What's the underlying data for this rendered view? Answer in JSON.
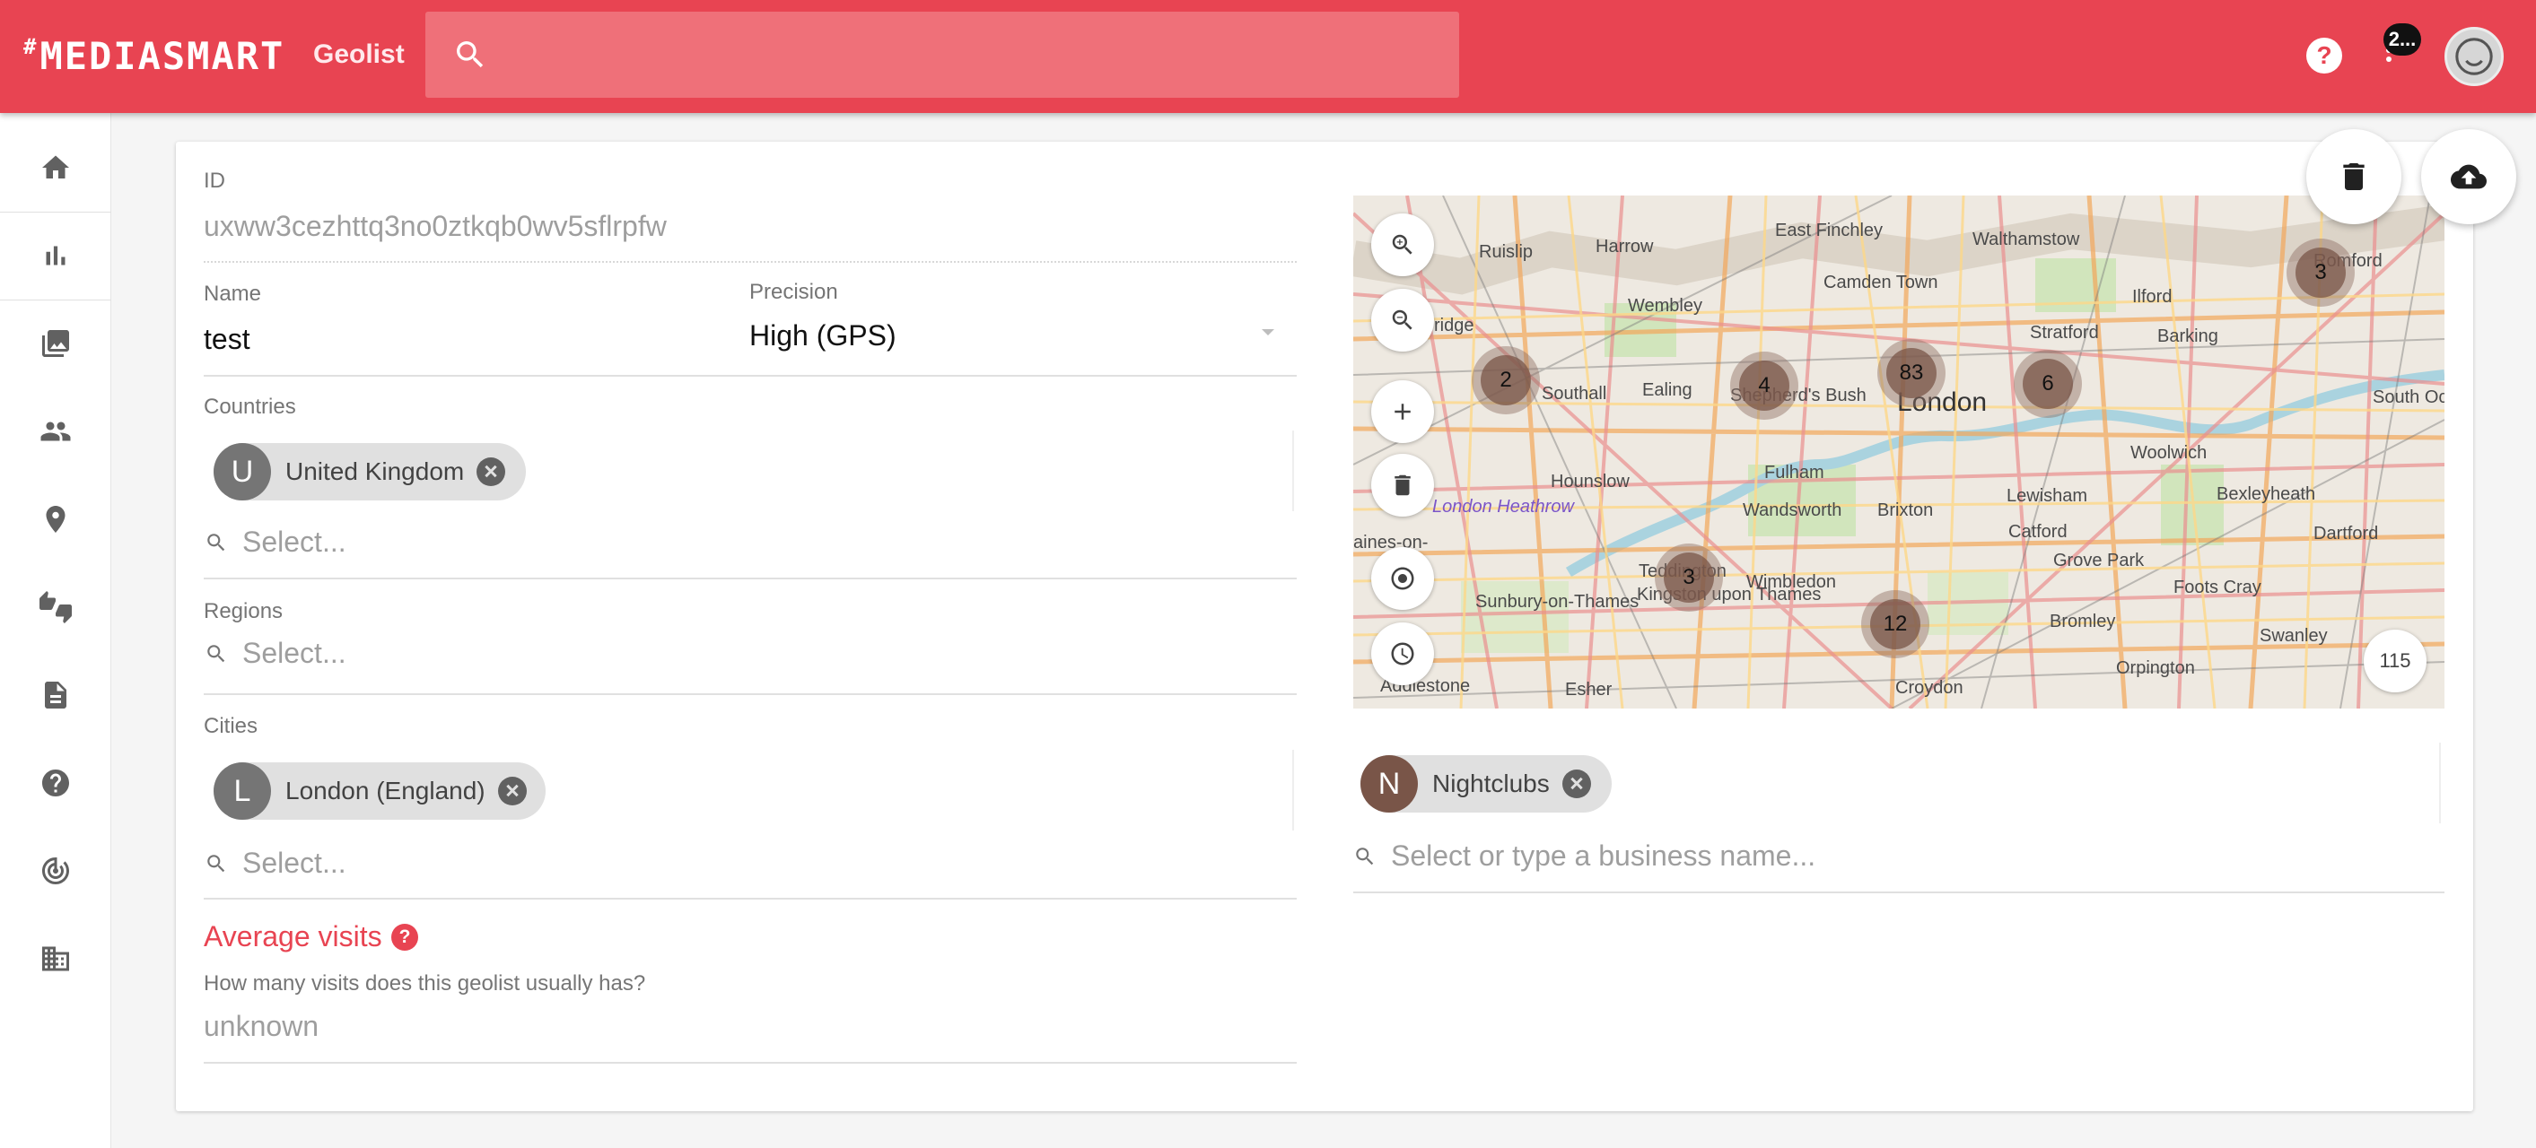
{
  "header": {
    "logo": "MEDIASMART",
    "logo_prefix": "#",
    "title": "Geolist",
    "search_placeholder": "",
    "notification_badge": "2...",
    "help_symbol": "?"
  },
  "sidebar": {
    "items": [
      {
        "name": "home",
        "icon": "home-icon"
      },
      {
        "name": "reports",
        "icon": "bar-chart-icon"
      },
      {
        "name": "creatives",
        "icon": "photo-library-icon"
      },
      {
        "name": "audiences",
        "icon": "people-icon"
      },
      {
        "name": "geolists",
        "icon": "location-pin-icon"
      },
      {
        "name": "feedback",
        "icon": "thumbs-up-down-icon"
      },
      {
        "name": "documents",
        "icon": "document-icon"
      },
      {
        "name": "help",
        "icon": "help-icon"
      },
      {
        "name": "tracking",
        "icon": "track-changes-icon"
      },
      {
        "name": "organization",
        "icon": "building-icon"
      }
    ]
  },
  "form": {
    "id_label": "ID",
    "id_value": "uxww3cezhttq3no0ztkqb0wv5sflrpfw",
    "name_label": "Name",
    "name_value": "test",
    "precision_label": "Precision",
    "precision_value": "High (GPS)",
    "countries_label": "Countries",
    "countries": [
      {
        "initial": "U",
        "label": "United Kingdom"
      }
    ],
    "countries_placeholder": "Select...",
    "regions_label": "Regions",
    "regions_placeholder": "Select...",
    "cities_label": "Cities",
    "cities": [
      {
        "initial": "L",
        "label": "London (England)"
      }
    ],
    "cities_placeholder": "Select...",
    "avg_visits_title": "Average visits",
    "avg_visits_help": "?",
    "avg_visits_question": "How many visits does this geolist usually has?",
    "avg_visits_value": "unknown"
  },
  "map": {
    "total_points": "115",
    "clusters": [
      {
        "count": "2"
      },
      {
        "count": "4"
      },
      {
        "count": "83"
      },
      {
        "count": "6"
      },
      {
        "count": "3"
      },
      {
        "count": "3"
      },
      {
        "count": "12"
      }
    ],
    "place_labels": [
      "Ruislip",
      "Harrow",
      "East Finchley",
      "Walthamstow",
      "Romford",
      "Wembley",
      "Camden Town",
      "Ilford",
      "Stratford",
      "Barking",
      "ridge",
      "Southall",
      "Ealing",
      "Shepherd's Bush",
      "London",
      "South Ocl",
      "Woolwich",
      "Hounslow",
      "Fulham",
      "Lewisham",
      "Bexleyheath",
      "London Heathrow",
      "Wandsworth",
      "Brixton",
      "Catford",
      "Dartford",
      "aines-on-",
      "Teddington",
      "Wimbledon",
      "Grove Park",
      "Foots Cray",
      "Sunbury-on-Thames",
      "Kingston upon Thames",
      "Bromley",
      "Swanley",
      "Addlestone",
      "Esher",
      "Croydon",
      "Orpington"
    ]
  },
  "business": {
    "chips": [
      {
        "initial": "N",
        "label": "Nightclubs"
      }
    ],
    "placeholder": "Select or type a business name..."
  },
  "colors": {
    "brand": "#e84452",
    "search_bg": "#ef7079",
    "chip_bg": "#e0e0e0",
    "chip_avatar": "#757575",
    "chip_avatar_business": "#795548",
    "cluster": "#8d6e63"
  }
}
